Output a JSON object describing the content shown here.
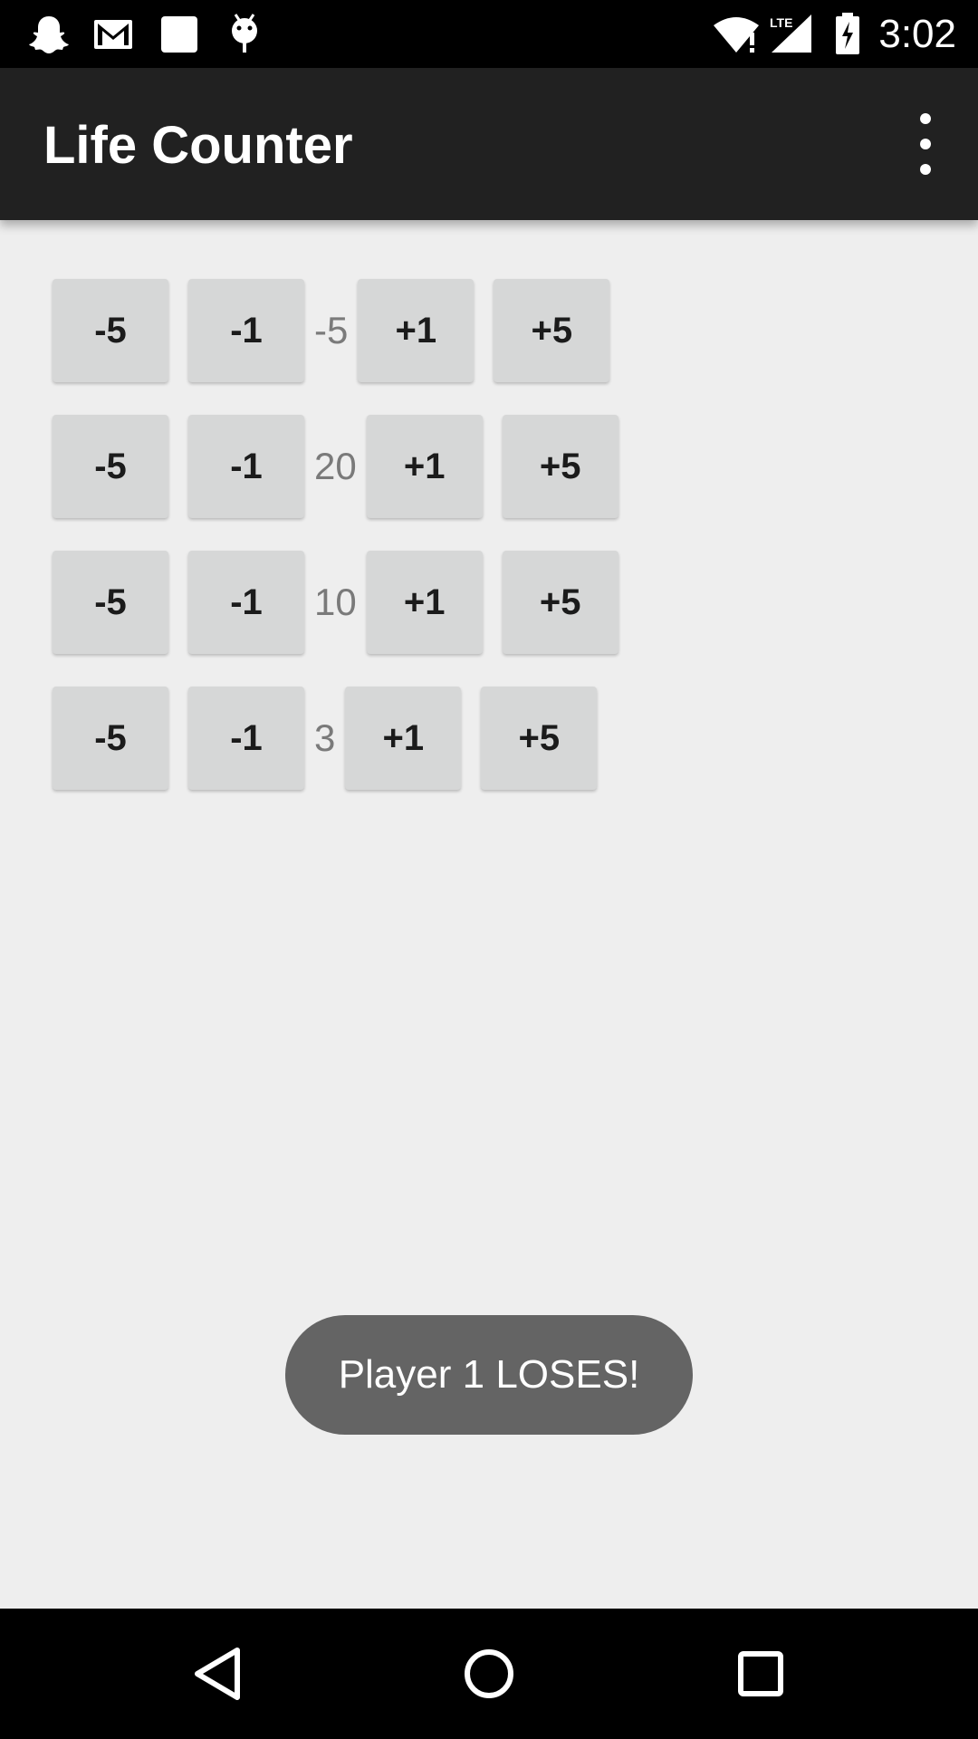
{
  "status_bar": {
    "time": "3:02",
    "icons": [
      "snapchat-icon",
      "gmail-icon",
      "notification-square-icon",
      "android-debug-icon",
      "wifi-alert-icon",
      "lte-signal-icon",
      "battery-charging-icon"
    ]
  },
  "app_bar": {
    "title": "Life Counter",
    "menu_icon": "more-vert-icon"
  },
  "counters": [
    {
      "minus5": "-5",
      "minus1": "-1",
      "life": "-5",
      "plus1": "+1",
      "plus5": "+5"
    },
    {
      "minus5": "-5",
      "minus1": "-1",
      "life": "20",
      "plus1": "+1",
      "plus5": "+5"
    },
    {
      "minus5": "-5",
      "minus1": "-1",
      "life": "10",
      "plus1": "+1",
      "plus5": "+5"
    },
    {
      "minus5": "-5",
      "minus1": "-1",
      "life": "3",
      "plus1": "+1",
      "plus5": "+5"
    }
  ],
  "toast": {
    "message": "Player 1 LOSES!"
  },
  "nav_bar": {
    "icons": [
      "back-icon",
      "home-icon",
      "recents-icon"
    ]
  },
  "colors": {
    "app_bar": "#212121",
    "background": "#eeeeee",
    "button": "#d6d7d7",
    "toast": "#646464"
  }
}
